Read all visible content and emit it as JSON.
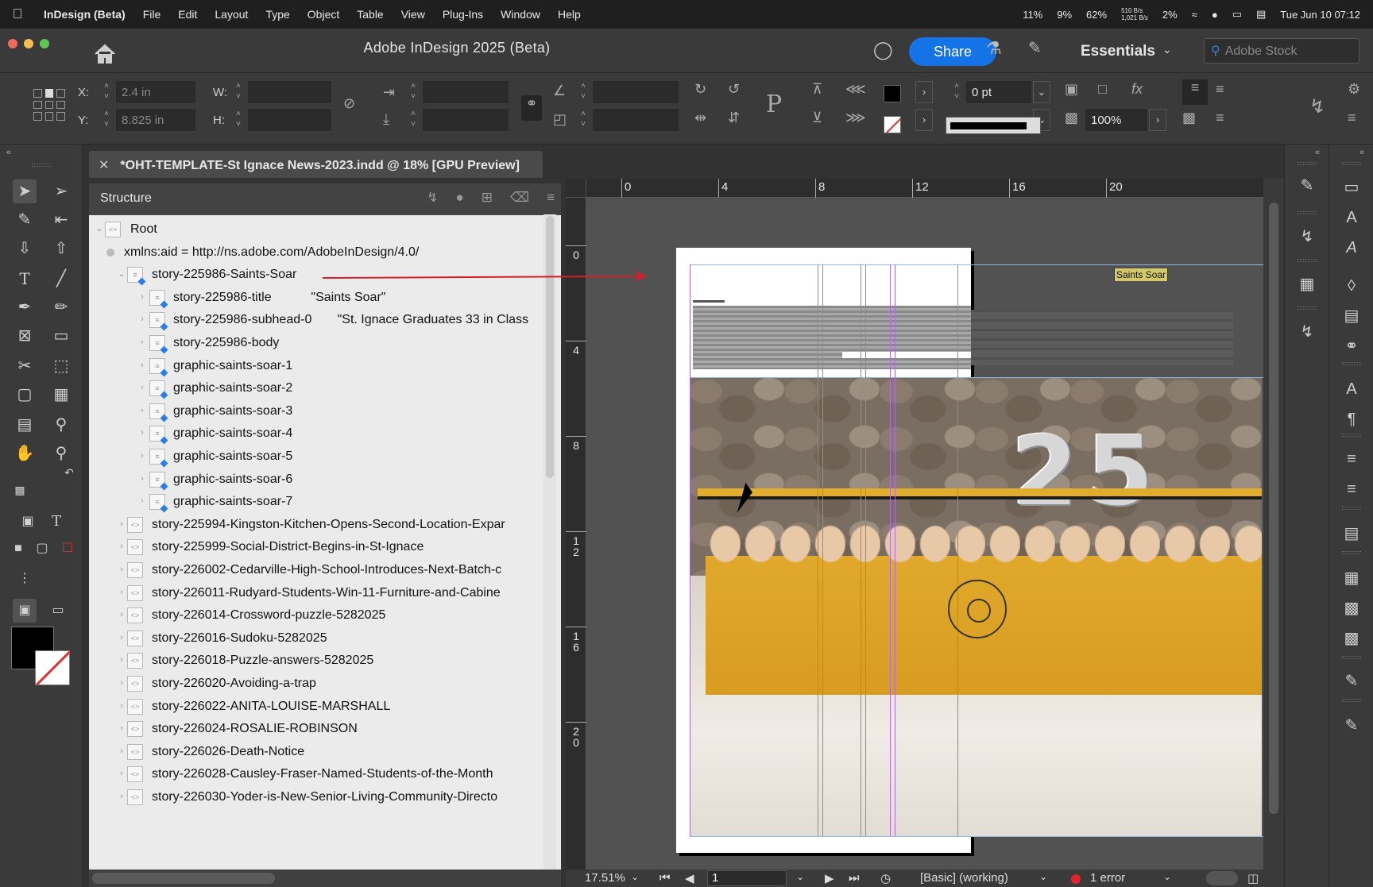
{
  "menubar": {
    "app_name": "InDesign (Beta)",
    "items": [
      "File",
      "Edit",
      "Layout",
      "Type",
      "Object",
      "Table",
      "View",
      "Plug-Ins",
      "Window",
      "Help"
    ],
    "status": {
      "cpu1": "11%",
      "cpu2": "9%",
      "battery_pct": "62%",
      "net_up": "510 B/s",
      "net_down": "1,021 B/s",
      "disk": "2%",
      "datetime": "Tue Jun 10  07:12"
    }
  },
  "titlebar": {
    "title": "Adobe InDesign 2025 (Beta)",
    "share_label": "Share",
    "workspace": "Essentials",
    "stock_placeholder": "Adobe Stock"
  },
  "control": {
    "x_label": "X:",
    "y_label": "Y:",
    "w_label": "W:",
    "h_label": "H:",
    "x_value": "2.4 in",
    "y_value": "8.825 in",
    "stroke_weight": "0 pt",
    "opacity": "100%"
  },
  "document": {
    "tab_title": "*OHT-TEMPLATE-St Ignace News-2023.indd @ 18% [GPU Preview]"
  },
  "structure": {
    "title": "Structure",
    "rows": [
      {
        "label": "Root",
        "kind": "root"
      },
      {
        "label": "xmlns:aid = http://ns.adobe.com/AdobeInDesign/4.0/",
        "kind": "attr"
      },
      {
        "label": "story-225986-Saints-Soar",
        "kind": "story-open"
      },
      {
        "label": "story-225986-title",
        "value": "\"Saints Soar\"",
        "kind": "child"
      },
      {
        "label": "story-225986-subhead-0",
        "value": "\"St. Ignace Graduates 33 in Class",
        "kind": "child"
      },
      {
        "label": "story-225986-body",
        "kind": "child"
      },
      {
        "label": "graphic-saints-soar-1",
        "kind": "child"
      },
      {
        "label": "graphic-saints-soar-2",
        "kind": "child"
      },
      {
        "label": "graphic-saints-soar-3",
        "kind": "child"
      },
      {
        "label": "graphic-saints-soar-4",
        "kind": "child"
      },
      {
        "label": "graphic-saints-soar-5",
        "kind": "child"
      },
      {
        "label": "graphic-saints-soar-6",
        "kind": "child"
      },
      {
        "label": "graphic-saints-soar-7",
        "kind": "child"
      },
      {
        "label": "story-225994-Kingston-Kitchen-Opens-Second-Location-Expar",
        "kind": "story"
      },
      {
        "label": "story-225999-Social-District-Begins-in-St-Ignace",
        "kind": "story"
      },
      {
        "label": "story-226002-Cedarville-High-School-Introduces-Next-Batch-c",
        "kind": "story"
      },
      {
        "label": "story-226011-Rudyard-Students-Win-11-Furniture-and-Cabine",
        "kind": "story"
      },
      {
        "label": "story-226014-Crossword-puzzle-5282025",
        "kind": "story"
      },
      {
        "label": "story-226016-Sudoku-5282025",
        "kind": "story"
      },
      {
        "label": "story-226018-Puzzle-answers-5282025",
        "kind": "story"
      },
      {
        "label": "story-226020-Avoiding-a-trap",
        "kind": "story"
      },
      {
        "label": "story-226022-ANITA-LOUISE-MARSHALL",
        "kind": "story"
      },
      {
        "label": "story-226024-ROSALIE-ROBINSON",
        "kind": "story"
      },
      {
        "label": "story-226026-Death-Notice",
        "kind": "story"
      },
      {
        "label": "story-226028-Causley-Fraser-Named-Students-of-the-Month",
        "kind": "story"
      },
      {
        "label": "story-226030-Yoder-is-New-Senior-Living-Community-Directo",
        "kind": "story"
      }
    ]
  },
  "canvas": {
    "ruler_h": [
      "0",
      "4",
      "8",
      "12",
      "16",
      "20"
    ],
    "ruler_v": [
      "0",
      "4",
      "8",
      "1\n2",
      "1\n6",
      "2\n0"
    ],
    "frame_label": "Saints Soar",
    "balloon_digits": [
      "2",
      "5"
    ]
  },
  "status": {
    "zoom": "17.51%",
    "page": "1",
    "preflight_profile": "[Basic] (working)",
    "errors": "1 error"
  },
  "colors": {
    "share_blue": "#1473e6",
    "guide_purple": "#b36be0",
    "error_red": "#e3232c",
    "arrow_red": "#d0202a"
  }
}
